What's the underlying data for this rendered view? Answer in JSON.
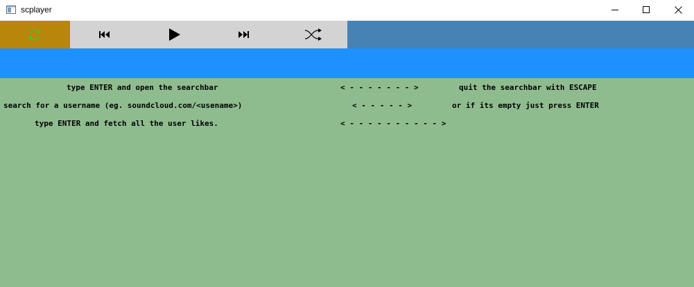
{
  "window": {
    "title": "scplayer"
  },
  "toolbar": {
    "refresh_icon": "refresh-icon",
    "previous_icon": "skip-previous-icon",
    "play_icon": "play-icon",
    "next_icon": "skip-next-icon",
    "shuffle_icon": "shuffle-icon"
  },
  "searchbar": {
    "value": ""
  },
  "instructions": {
    "rows": [
      {
        "action": "type ENTER and open the searchbar",
        "arrow": "< - - - - - - - >",
        "result": "quit the searchbar with ESCAPE"
      },
      {
        "action": "search for a username (eg. soundcloud.com/<usename>)",
        "arrow": "< - - - - - >",
        "result": "or if its empty just press ENTER"
      },
      {
        "action": "type ENTER and fetch all the user likes.",
        "arrow": "< - - - - - - - - - - >",
        "result": ""
      }
    ]
  },
  "colors": {
    "toolbar_bg": "#4682b4",
    "refresh_bg": "#b8860b",
    "controls_bg": "#d3d3d3",
    "searchbar_bg": "#1e90ff",
    "content_bg": "#8fbc8f",
    "refresh_icon_color": "#32cd32"
  }
}
